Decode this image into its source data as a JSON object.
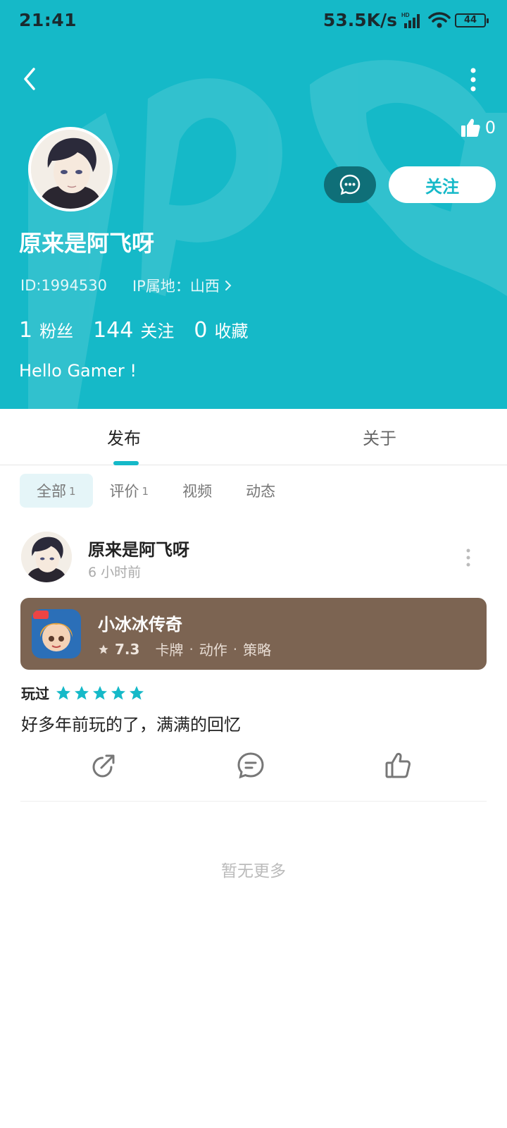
{
  "status_bar": {
    "time": "21:41",
    "net_speed": "53.5K/s",
    "battery": "44",
    "signal_icon": "signal-icon",
    "wifi_icon": "wifi-icon"
  },
  "header": {
    "likes_count": "0",
    "follow_label": "关注",
    "username": "原来是阿飞呀",
    "id_text": "ID:1994530",
    "ip_text": "IP属地：山西",
    "stats": [
      {
        "num": "1",
        "label": "粉丝"
      },
      {
        "num": "144",
        "label": "关注"
      },
      {
        "num": "0",
        "label": "收藏"
      }
    ],
    "bio": "Hello Gamer !"
  },
  "tabs": [
    {
      "label": "发布",
      "active": true
    },
    {
      "label": "关于",
      "active": false
    }
  ],
  "filters": [
    {
      "label": "全部",
      "count": "1",
      "active": true
    },
    {
      "label": "评价",
      "count": "1",
      "active": false
    },
    {
      "label": "视频",
      "count": "",
      "active": false
    },
    {
      "label": "动态",
      "count": "",
      "active": false
    }
  ],
  "post": {
    "username": "原来是阿飞呀",
    "time": "6 小时前",
    "game": {
      "name": "小冰冰传奇",
      "score": "7.3",
      "tags": [
        "卡牌",
        "动作",
        "策略"
      ]
    },
    "played_label": "玩过",
    "rating_stars": 5,
    "review": "好多年前玩的了，满满的回忆"
  },
  "footer": {
    "no_more": "暂无更多"
  },
  "colors": {
    "accent": "#15b9c8",
    "message_button": "#0f6f78",
    "game_card": "#7c6452"
  }
}
